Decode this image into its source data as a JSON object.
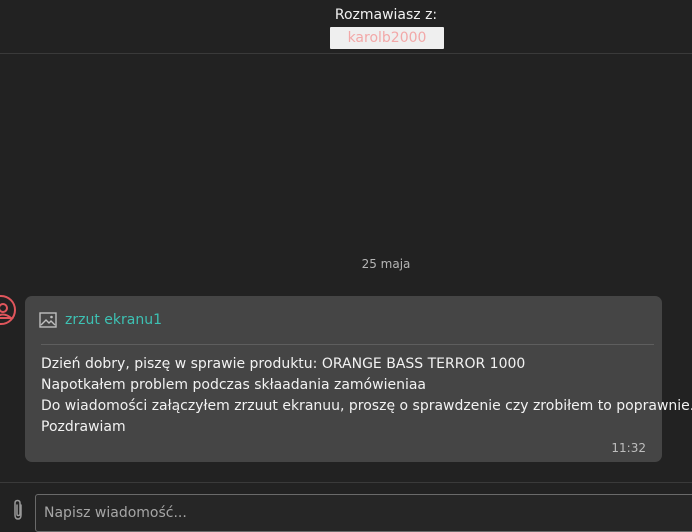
{
  "header": {
    "label": "Rozmawiasz z:",
    "contact_name": "karolb2000"
  },
  "conversation": {
    "date_separator": "25 maja",
    "message": {
      "attachment": {
        "icon": "image-icon",
        "name": "zrzut ekranu1"
      },
      "lines": [
        "Dzień dobry, piszę w sprawie produktu: ORANGE BASS TERROR 1000",
        "Napotkałem problem podczas skłaadania zamówieniaa",
        "Do wiadomości załączyłem zrzuut ekranuu, proszę o sprawdzenie czy zrobiłem to poprawnie.",
        "Pozdrawiam"
      ],
      "time": "11:32"
    }
  },
  "composer": {
    "placeholder": "Napisz wiadomość...",
    "value": ""
  },
  "colors": {
    "background": "#222222",
    "bubble": "#454545",
    "link": "#3dc1b3",
    "avatar_accent": "#e0565c",
    "contact_name": "#f2a8a8"
  }
}
